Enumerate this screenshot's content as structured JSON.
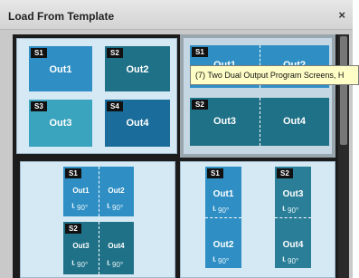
{
  "dialog": {
    "title": "Load From Template",
    "close_glyph": "×"
  },
  "templates": [
    {
      "screens": [
        {
          "badge": "S1",
          "label": "Out1"
        },
        {
          "badge": "S2",
          "label": "Out2"
        },
        {
          "badge": "S3",
          "label": "Out3"
        },
        {
          "badge": "S4",
          "label": "Out4"
        }
      ]
    },
    {
      "screens": [
        {
          "badge": "S1",
          "labels": [
            "Out1",
            "Out2"
          ]
        },
        {
          "badge": "S2",
          "labels": [
            "Out3",
            "Out4"
          ]
        }
      ]
    },
    {
      "screens": [
        {
          "badge": "S1",
          "labels": [
            "Out1",
            "Out2"
          ],
          "rotations": [
            "90°",
            "90°"
          ]
        },
        {
          "badge": "S2",
          "labels": [
            "Out3",
            "Out4"
          ],
          "rotations": [
            "90°",
            "90°"
          ]
        }
      ]
    },
    {
      "screens": [
        {
          "badge": "S1",
          "labels": [
            "Out1",
            "Out2"
          ],
          "rotations": [
            "90°",
            "90°"
          ]
        },
        {
          "badge": "S2",
          "labels": [
            "Out3",
            "Out4"
          ],
          "rotations": [
            "90°",
            "90°"
          ]
        }
      ]
    }
  ],
  "tooltip": {
    "text": "(7) Two Dual Output Program Screens, H"
  },
  "rotate_icon": "rotate-90-icon"
}
